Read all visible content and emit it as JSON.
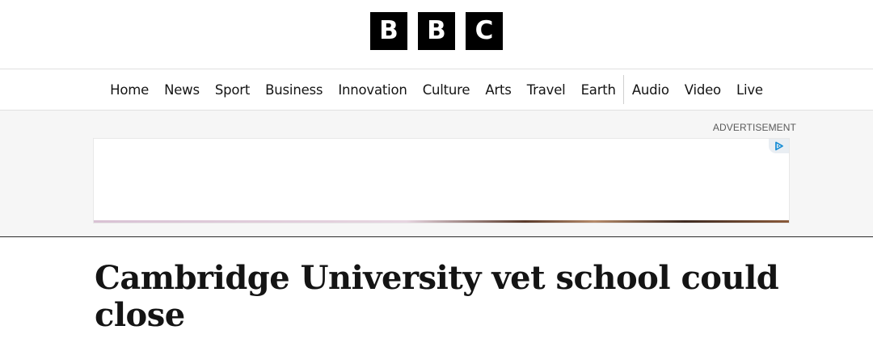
{
  "logo": {
    "letters": [
      "B",
      "B",
      "C"
    ]
  },
  "nav": {
    "items": [
      {
        "label": "Home"
      },
      {
        "label": "News"
      },
      {
        "label": "Sport"
      },
      {
        "label": "Business"
      },
      {
        "label": "Innovation"
      },
      {
        "label": "Culture"
      },
      {
        "label": "Arts"
      },
      {
        "label": "Travel"
      },
      {
        "label": "Earth"
      },
      {
        "label": "Audio"
      },
      {
        "label": "Video"
      },
      {
        "label": "Live"
      }
    ]
  },
  "ad": {
    "label": "ADVERTISEMENT",
    "choices_icon": "adchoices-icon"
  },
  "article": {
    "headline": "Cambridge University vet school could close"
  },
  "colors": {
    "logo_bg": "#000000",
    "logo_fg": "#ffffff",
    "ad_band_bg": "#f6f6f6",
    "text": "#141414"
  }
}
